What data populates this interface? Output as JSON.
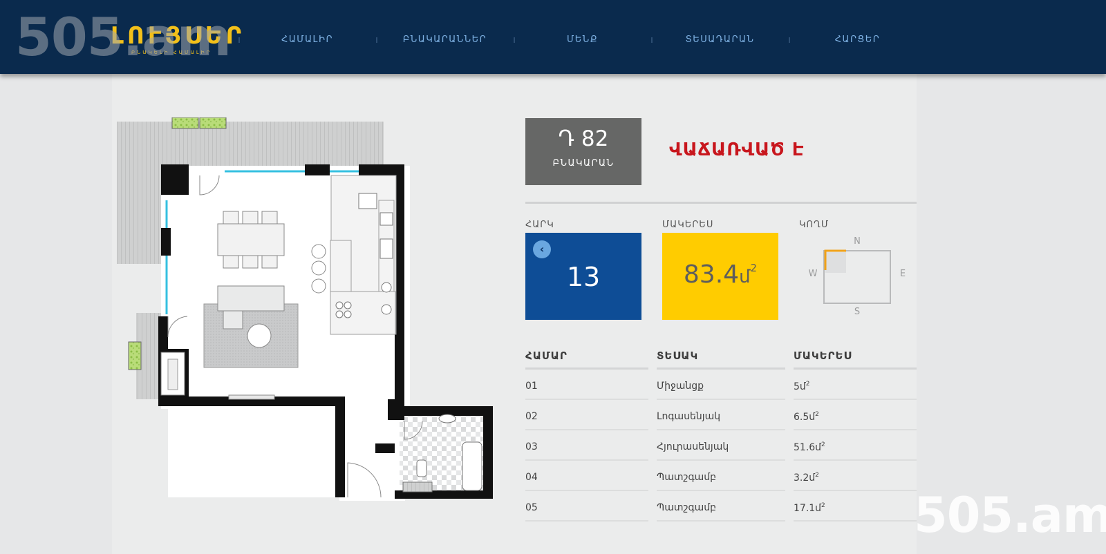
{
  "watermark": "505.am",
  "header": {
    "logo_title": "ԼՈՒՅՍԵՐ",
    "logo_subtitle": "ԲՆԱԿԵԼԻ ՀԱՄԱԼԻՐ",
    "nav": [
      {
        "label": "ՀԱՄԱԼԻՐ"
      },
      {
        "label": "ԲՆԱԿԱՐԱՆՆԵՐ"
      },
      {
        "label": "ՄԵՆՔ"
      },
      {
        "label": "ՏԵՍԱԴԱՐԱՆ"
      },
      {
        "label": "ՀԱՐՑԵՐ"
      }
    ]
  },
  "apartment": {
    "number": "Դ 82",
    "label": "ԲՆԱԿԱՐԱՆ",
    "status": "ՎԱՃԱՌՎԱԾ Է",
    "status_color": "#c8161d"
  },
  "cards": {
    "floor_label": "ՀԱՐԿ",
    "floor_value": "13",
    "area_label": "ՄԱԿԵՐԵՍ",
    "area_value": "83.4",
    "area_unit": "մ",
    "area_power": "2",
    "orientation_label": "ԿՈՂՄ",
    "compass": {
      "n": "N",
      "s": "S",
      "e": "E",
      "w": "W"
    }
  },
  "rooms": {
    "headers": {
      "number": "ՀԱՄԱՐ",
      "type": "ՏԵՍԱԿ",
      "area": "ՄԱԿԵՐԵՍ"
    },
    "rows": [
      {
        "number": "01",
        "type": "Միջանցք",
        "area": "5մ",
        "power": "2"
      },
      {
        "number": "02",
        "type": "Լոգասենյակ",
        "area": "6.5մ",
        "power": "2"
      },
      {
        "number": "03",
        "type": "Հյուրասենյակ",
        "area": "51.6մ",
        "power": "2"
      },
      {
        "number": "04",
        "type": "Պատշգամբ",
        "area": "3.2մ",
        "power": "2"
      },
      {
        "number": "05",
        "type": "Պատշգամբ",
        "area": "17.1մ",
        "power": "2"
      }
    ]
  },
  "colors": {
    "header_bg": "#0a2a4d",
    "floor_card": "#0e4d96",
    "area_card": "#ffcc00",
    "apt_box": "#666766",
    "logo": "#f2c01a"
  }
}
